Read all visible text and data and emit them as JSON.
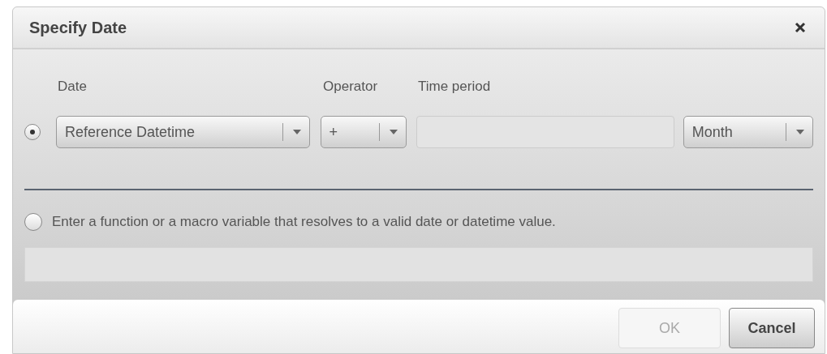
{
  "dialog": {
    "title": "Specify Date"
  },
  "option_1": {
    "selected": true,
    "labels": [
      "Date",
      "Operator",
      "Time period"
    ],
    "date_select": {
      "value": "Reference Datetime"
    },
    "operator_select": {
      "value": "+"
    },
    "unit_select": {
      "value": "Month"
    }
  },
  "option_2": {
    "selected": false,
    "label": "Enter a function or a macro variable that resolves to a valid date or datetime value."
  },
  "buttons": [
    {
      "label": "OK",
      "disabled": true
    },
    {
      "label": "Cancel",
      "disabled": false
    }
  ]
}
